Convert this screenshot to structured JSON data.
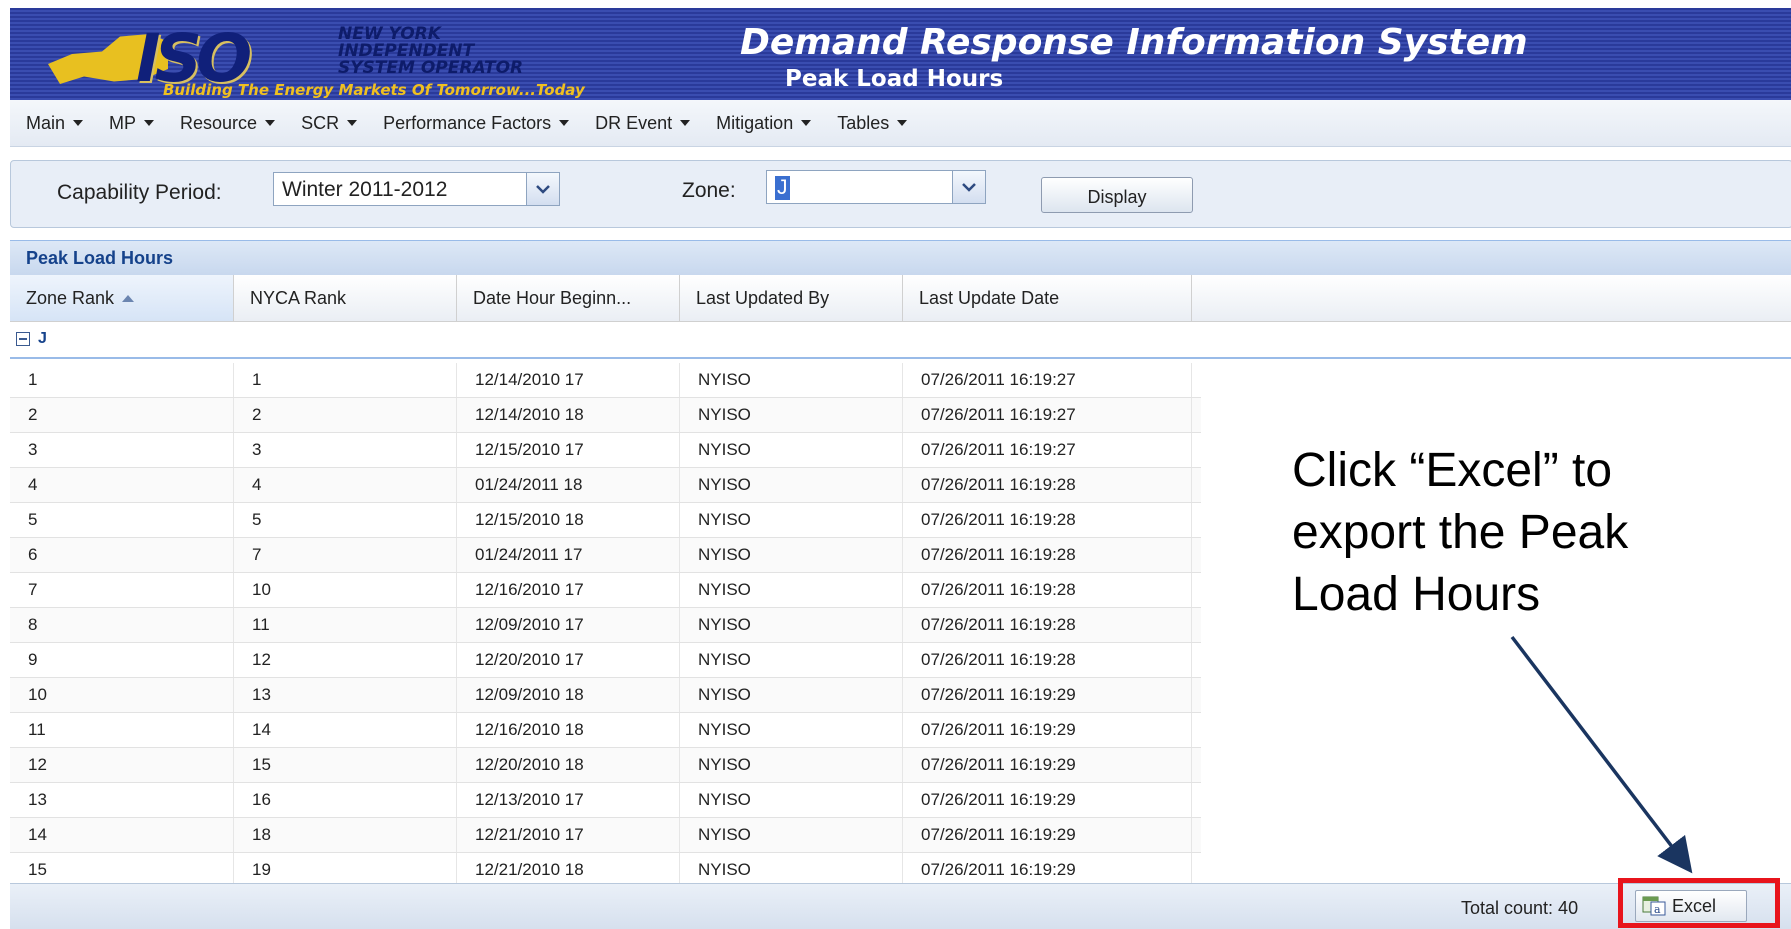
{
  "header": {
    "logo_text": "ISO",
    "logo_lines": [
      "NEW YORK",
      "INDEPENDENT",
      "SYSTEM OPERATOR"
    ],
    "logo_tagline": "Building The Energy Markets Of Tomorrow...Today",
    "app_title": "Demand Response Information System",
    "page_subtitle": "Peak Load Hours"
  },
  "menu": [
    {
      "label": "Main"
    },
    {
      "label": "MP"
    },
    {
      "label": "Resource"
    },
    {
      "label": "SCR"
    },
    {
      "label": "Performance Factors"
    },
    {
      "label": "DR Event"
    },
    {
      "label": "Mitigation"
    },
    {
      "label": "Tables"
    }
  ],
  "filters": {
    "capability_period_label": "Capability Period:",
    "capability_period_value": "Winter 2011-2012",
    "zone_label": "Zone:",
    "zone_value": "J",
    "display_label": "Display"
  },
  "grid": {
    "title": "Peak Load Hours",
    "columns": [
      "Zone Rank",
      "NYCA Rank",
      "Date Hour Beginn...",
      "Last Updated By",
      "Last Update Date"
    ],
    "sorted_column": "Zone Rank",
    "group_label": "J",
    "rows": [
      [
        "1",
        "1",
        "12/14/2010 17",
        "NYISO",
        "07/26/2011 16:19:27"
      ],
      [
        "2",
        "2",
        "12/14/2010 18",
        "NYISO",
        "07/26/2011 16:19:27"
      ],
      [
        "3",
        "3",
        "12/15/2010 17",
        "NYISO",
        "07/26/2011 16:19:27"
      ],
      [
        "4",
        "4",
        "01/24/2011 18",
        "NYISO",
        "07/26/2011 16:19:28"
      ],
      [
        "5",
        "5",
        "12/15/2010 18",
        "NYISO",
        "07/26/2011 16:19:28"
      ],
      [
        "6",
        "7",
        "01/24/2011 17",
        "NYISO",
        "07/26/2011 16:19:28"
      ],
      [
        "7",
        "10",
        "12/16/2010 17",
        "NYISO",
        "07/26/2011 16:19:28"
      ],
      [
        "8",
        "11",
        "12/09/2010 17",
        "NYISO",
        "07/26/2011 16:19:28"
      ],
      [
        "9",
        "12",
        "12/20/2010 17",
        "NYISO",
        "07/26/2011 16:19:28"
      ],
      [
        "10",
        "13",
        "12/09/2010 18",
        "NYISO",
        "07/26/2011 16:19:29"
      ],
      [
        "11",
        "14",
        "12/16/2010 18",
        "NYISO",
        "07/26/2011 16:19:29"
      ],
      [
        "12",
        "15",
        "12/20/2010 18",
        "NYISO",
        "07/26/2011 16:19:29"
      ],
      [
        "13",
        "16",
        "12/13/2010 17",
        "NYISO",
        "07/26/2011 16:19:29"
      ],
      [
        "14",
        "18",
        "12/21/2010 17",
        "NYISO",
        "07/26/2011 16:19:29"
      ],
      [
        "15",
        "19",
        "12/21/2010 18",
        "NYISO",
        "07/26/2011 16:19:29"
      ]
    ]
  },
  "footer": {
    "total_count": "Total count: 40",
    "excel_label": "Excel"
  },
  "annotation": {
    "text": "Click “Excel” to export the Peak Load Hours"
  },
  "colors": {
    "banner": "#2f3fa3",
    "logo_gold": "#e8c020",
    "grid_title": "#15428b",
    "highlight": "#e8141c",
    "arrow": "#1a3560"
  }
}
